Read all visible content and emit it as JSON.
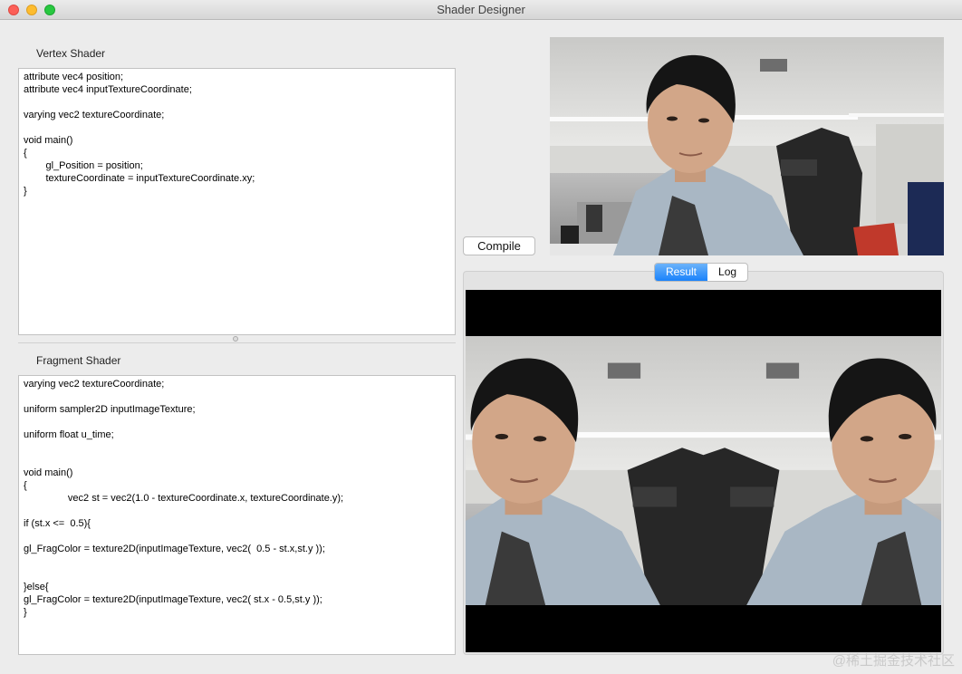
{
  "window": {
    "title": "Shader Designer"
  },
  "vertex": {
    "label": "Vertex Shader",
    "code": "attribute vec4 position;\nattribute vec4 inputTextureCoordinate;\n\nvarying vec2 textureCoordinate;\n\nvoid main()\n{\n\tgl_Position = position;\n\ttextureCoordinate = inputTextureCoordinate.xy;\n}"
  },
  "fragment": {
    "label": "Fragment Shader",
    "code": "varying vec2 textureCoordinate;\n\nuniform sampler2D inputImageTexture;\n\nuniform float u_time;\n\n\nvoid main()\n{\n\t\tvec2 st = vec2(1.0 - textureCoordinate.x, textureCoordinate.y);\n\nif (st.x <=  0.5){\n\ngl_FragColor = texture2D(inputImageTexture, vec2(  0.5 - st.x,st.y ));\n\n\n}else{\ngl_FragColor = texture2D(inputImageTexture, vec2( st.x - 0.5,st.y ));\n}"
  },
  "toolbar": {
    "compile_label": "Compile"
  },
  "tabs": {
    "result": "Result",
    "log": "Log",
    "active": "result"
  },
  "watermark": "@稀土掘金技术社区",
  "colors": {
    "tab_active": "#1a82fb",
    "close": "#fc5f57",
    "minimize": "#fdbc2e",
    "maximize": "#28c840"
  }
}
